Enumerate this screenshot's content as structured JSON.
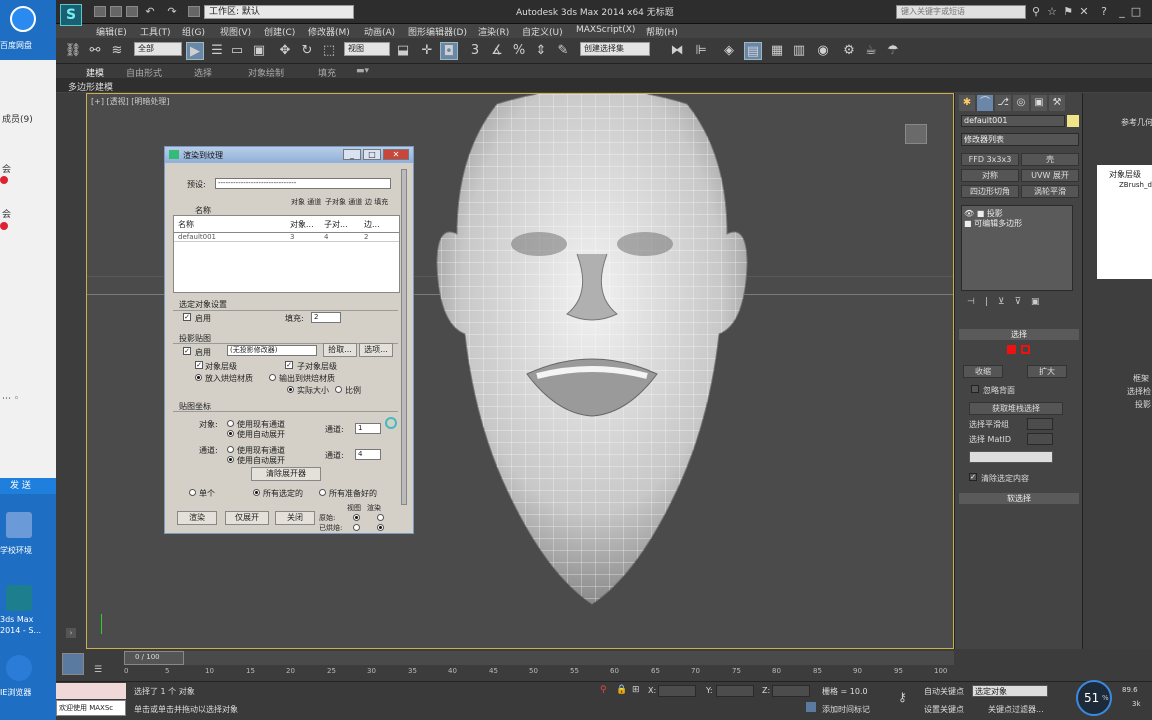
{
  "desktop": {
    "baidu_label": "百度网盘",
    "member_count": "成员(9)",
    "chat_label_1": "会",
    "chat_label_2": "会",
    "send_label": "发 送",
    "icon1_label": "学校环境",
    "icon2_line1": "3ds Max",
    "icon2_line2": "2014 - S...",
    "icon3_label": "IE浏览器"
  },
  "titlebar": {
    "workspace": "工作区: 默认",
    "title": "Autodesk 3ds Max  2014 x64     无标题",
    "search_placeholder": "键入关键字或短语"
  },
  "menu": [
    "编辑(E)",
    "工具(T)",
    "组(G)",
    "视图(V)",
    "创建(C)",
    "修改器(M)",
    "动画(A)",
    "图形编辑器(D)",
    "渲染(R)",
    "自定义(U)",
    "MAXScript(X)",
    "帮助(H)"
  ],
  "toolbar": {
    "filter": "全部",
    "ref_coord": "视图",
    "selection_set": "创建选择集"
  },
  "ribbon": {
    "tabs": [
      "建模",
      "自由形式",
      "选择",
      "对象绘制",
      "填充"
    ],
    "sub": "多边形建模"
  },
  "viewport": {
    "label": "[+] [透视] [明暗处理]"
  },
  "dialog": {
    "title": "渲染到纹理",
    "preset_label": "预设:",
    "preset_value": "-------------------------------",
    "col_name": "名称",
    "col_obj": "对象...",
    "col_sub": "子对...",
    "col_edge": "边...",
    "hdr_obj": "对象 通道",
    "hdr_sub": "子对象 通道",
    "hdr_edge": "边 填充",
    "row_name": "default001",
    "row_obj": "3",
    "row_sub": "4",
    "row_edge": "2",
    "sel_group": "选定对象设置",
    "enable": "启用",
    "fill": "填充:",
    "fill_value": "2",
    "proj_group": "投影贴图",
    "proj_enable": "启用",
    "proj_value": "(无投影修改器)",
    "pick": "拾取...",
    "options": "选项...",
    "obj_level": "对象层级",
    "sub_level": "子对象层级",
    "put_baked": "放入烘焙材质",
    "out_baked": "输出到烘焙材质",
    "actual_size": "实际大小",
    "ratio": "比例",
    "uv_group": "贴图坐标",
    "obj_label": "对象:",
    "use_existing": "使用现有通道",
    "use_auto": "使用自动展开",
    "channel": "通道:",
    "channel1": "1",
    "sub_label": "通道:",
    "use_existing2": "使用现有通道",
    "use_auto2": "使用自动展开",
    "channel2": "通道:",
    "channel2_val": "4",
    "clear_unwrapper": "清除展开器",
    "single": "单个",
    "all_selected": "所有选定的",
    "all_prepared": "所有准备好的",
    "render": "渲染",
    "unwrap_only": "仅展开",
    "close": "关闭",
    "view_label": "视图",
    "render_label": "渲染",
    "original": "原始:",
    "baked": "已烘焙:"
  },
  "cmd": {
    "object_name": "default001",
    "modifier_list": "修改器列表",
    "btn_ffd": "FFD 3x3x3",
    "btn_shell": "壳",
    "btn_symmetry": "对称",
    "btn_uvw": "UVW 展开",
    "btn_quadify": "四边形切角",
    "btn_turbosmooth": "涡轮平滑",
    "stack_item1": "投影",
    "stack_item2": "可编辑多边形",
    "selection_rollout": "选择",
    "shrink": "收缩",
    "grow": "扩大",
    "ignore_backfacing": "忽略背面",
    "get_stack_sel": "获取堆栈选择",
    "sel_by_smooth": "选择平滑组",
    "sel_by_matid": "选择 MatID",
    "clear_sel": "清除选定内容",
    "soft_sel": "软选择"
  },
  "rightcol": {
    "header": "参考几何",
    "tree_root": "对象层级",
    "tree_child": "ZBrush_de",
    "rollout1": "框架",
    "rollout2": "选择检",
    "rollout3": "投影"
  },
  "timeline": {
    "frame": "0 / 100",
    "ticks": [
      "0",
      "5",
      "10",
      "15",
      "20",
      "25",
      "30",
      "35",
      "40",
      "45",
      "50",
      "55",
      "60",
      "65",
      "70",
      "75",
      "80",
      "85",
      "90",
      "95",
      "100"
    ]
  },
  "status": {
    "welcome": "欢迎使用 MAXSc",
    "selected": "选择了 1 个 对象",
    "prompt": "单击或单击并拖动以选择对象",
    "x_label": "X:",
    "y_label": "Y:",
    "z_label": "Z:",
    "grid": "栅格 = 10.0",
    "auto_key": "自动关键点",
    "set_key": "设置关键点",
    "selected_obj": "选定对象",
    "key_filter": "关键点过滤器...",
    "add_time_tag": "添加时间标记",
    "perf_value": "51",
    "perf_unit": "%",
    "net_up": "89.6",
    "net_down": "3k"
  }
}
